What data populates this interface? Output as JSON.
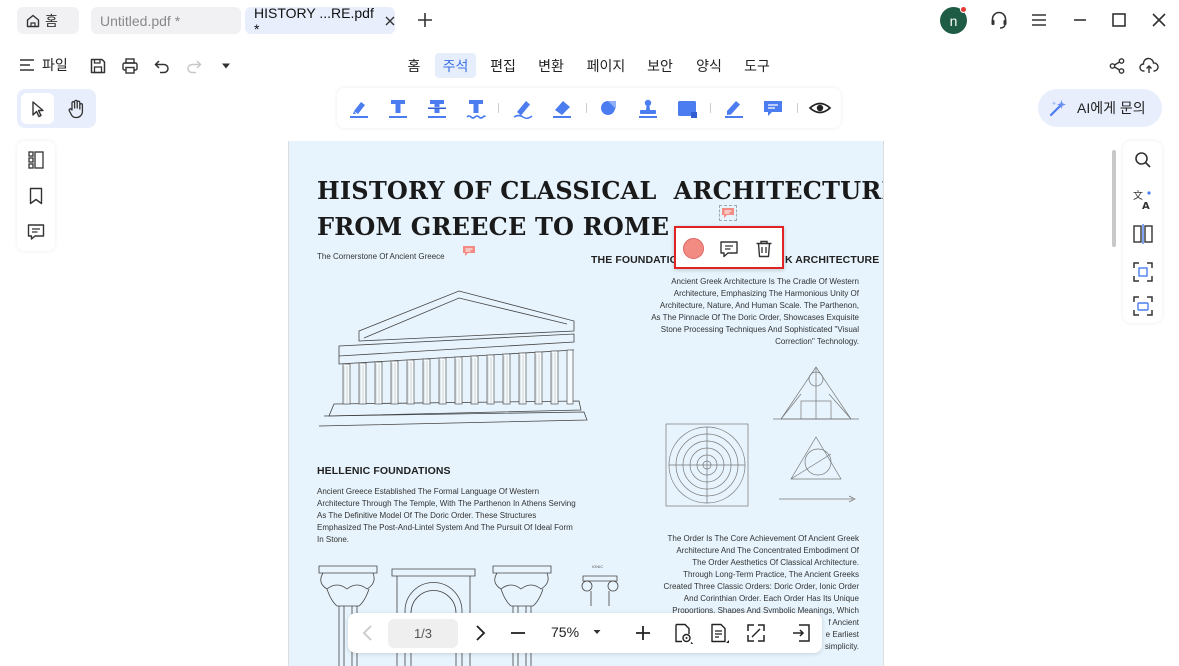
{
  "tabs": {
    "home": "홈",
    "untitled": "Untitled.pdf *",
    "active": "HISTORY ...RE.pdf *",
    "avatar_letter": "n"
  },
  "menu": {
    "file": "파일",
    "items": [
      "홈",
      "주석",
      "편집",
      "변환",
      "페이지",
      "보안",
      "양식",
      "도구"
    ],
    "active_index": 1
  },
  "ai_button": "AI에게 문의",
  "document": {
    "title_line1": "HISTORY OF CLASSICAL  ARCHITECTURE:",
    "title_line2": "FROM GREECE TO ROME",
    "subtitle": "The Cornerstone Of Ancient Greece",
    "foundation_heading_left": "THE FOUNDATIO",
    "foundation_heading_right": "K ARCHITECTURE",
    "greek_para": [
      "Ancient Greek Architecture Is The Cradle Of Western",
      "Architecture, Emphasizing The Harmonious Unity Of",
      "Architecture, Nature, And Human Scale. The Parthenon,",
      "As The Pinnacle Of The Doric Order, Showcases Exquisite",
      "Stone Processing Techniques And Sophisticated \"Visual",
      "Correction\" Technology."
    ],
    "hellenic_heading": "HELLENIC FOUNDATIONS",
    "hellenic_para": [
      "Ancient Greece Established The Formal Language Of Western",
      "Architecture Through The Temple, With The Parthenon In Athens Serving",
      "As The Definitive Model Of The Doric Order. These Structures",
      "Emphasized The Post-And-Lintel System And The Pursuit Of Ideal Form",
      "In Stone."
    ],
    "order_para": [
      "The Order Is The Core Achievement Of Ancient Greek",
      "Architecture And The Concentrated Embodiment Of",
      "The Order Aesthetics Of Classical Architecture.",
      "Through Long-Term Practice, The Ancient Greeks",
      "Created Three Classic Orders: Doric Order, Ionic Order",
      "And Corinthian Order. Each Order Has Its Unique",
      "Proportions, Shapes And Symbolic Meanings, Which",
      "f Ancient",
      "e Earliest",
      "simplicity."
    ],
    "ionic_label": "IONIC"
  },
  "pagination": {
    "page": "1/3",
    "zoom": "75%"
  },
  "colors": {
    "accent": "#3b6fe4",
    "page_bg": "#e7f4fd",
    "annotation_red": "#f28b82",
    "selection_border": "#e02424",
    "avatar_bg": "#1f5c45"
  }
}
